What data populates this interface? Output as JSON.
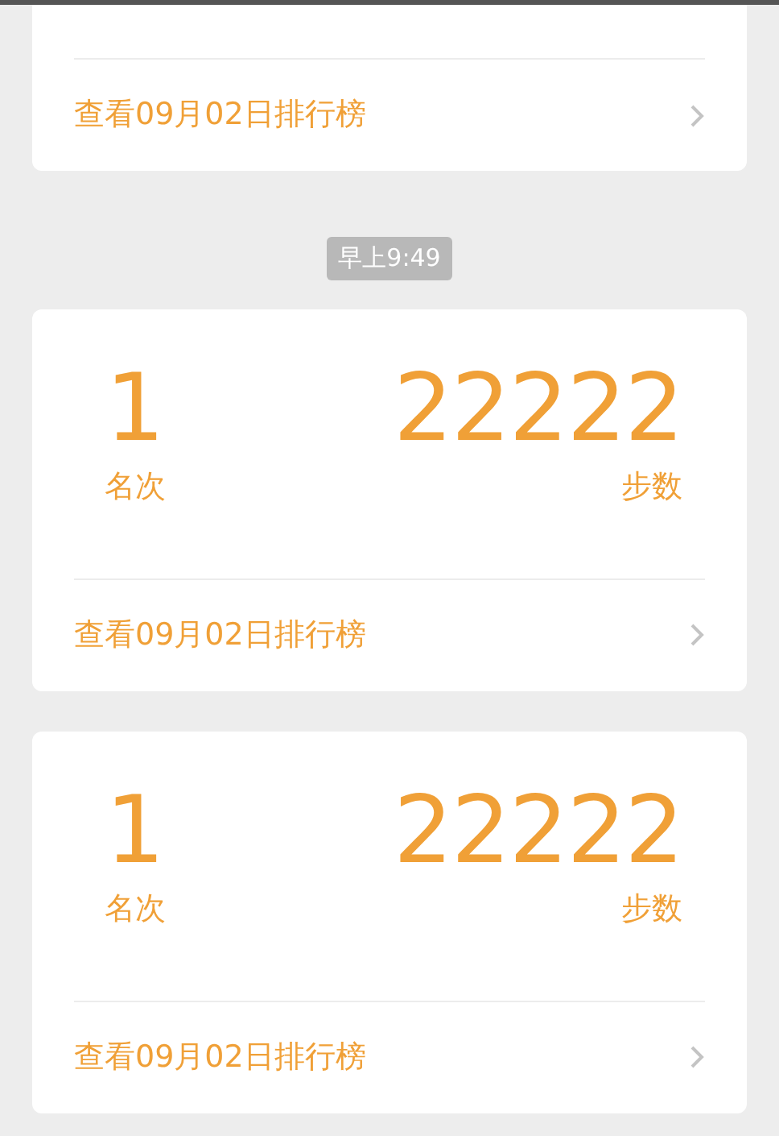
{
  "top_card": {
    "link": "查看09月02日排行榜"
  },
  "timestamp": "早上9:49",
  "cards": [
    {
      "rank": "1",
      "rank_label": "名次",
      "steps": "22222",
      "steps_label": "步数",
      "link": "查看09月02日排行榜"
    },
    {
      "rank": "1",
      "rank_label": "名次",
      "steps": "22222",
      "steps_label": "步数",
      "link": "查看09月02日排行榜"
    }
  ]
}
